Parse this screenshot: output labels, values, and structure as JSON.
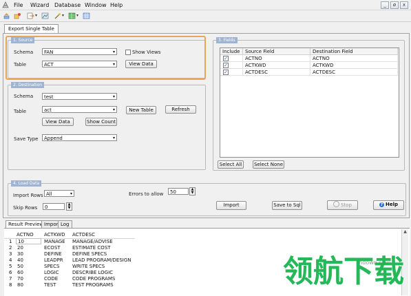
{
  "menu": [
    "File",
    "Wizard",
    "Database",
    "Window",
    "Help"
  ],
  "window_controls": [
    "_",
    "ø",
    "x"
  ],
  "document_tab": "Export Single Table",
  "source": {
    "title": "1. Source",
    "schema_label": "Schema",
    "schema_value": "FAN",
    "table_label": "Table",
    "table_value": "ACT",
    "show_views_label": "Show Views",
    "view_data_label": "View Data"
  },
  "destination": {
    "title": "2. Destination",
    "schema_label": "Schema",
    "schema_value": "test",
    "table_label": "Table",
    "table_value": "act",
    "new_table_label": "New Table",
    "refresh_label": "Refresh",
    "view_data_label": "View Data",
    "show_count_label": "Show Count",
    "save_type_label": "Save Type",
    "save_type_value": "Append"
  },
  "fields": {
    "title": "3. Fields",
    "headers": [
      "Include",
      "Source Field",
      "Destination Field"
    ],
    "rows": [
      {
        "source": "ACTNO",
        "dest": "ACTNO"
      },
      {
        "source": "ACTKWD",
        "dest": "ACTKWD"
      },
      {
        "source": "ACTDESC",
        "dest": "ACTDESC"
      }
    ],
    "select_all_label": "Select All",
    "select_none_label": "Select None"
  },
  "load": {
    "title": "4. Load Data",
    "import_rows_label": "Import Rows",
    "import_rows_value": "All",
    "skip_rows_label": "Skip Rows",
    "skip_rows_value": "0",
    "errors_label": "Errors to allow",
    "errors_value": "50",
    "import_label": "Import",
    "save_sql_label": "Save to Sql",
    "stop_label": "Stop",
    "help_label": "Help"
  },
  "panel_tabs": [
    "Result Preview",
    "Import",
    "Log"
  ],
  "preview": {
    "headers": [
      "ACTNO",
      "ACTKWD",
      "ACTDESC"
    ],
    "rows": [
      [
        "1",
        "10",
        "MANAGE",
        "MANAGE/ADVISE"
      ],
      [
        "2",
        "20",
        "ECOST",
        "ESTIMATE COST"
      ],
      [
        "3",
        "30",
        "DEFINE",
        "DEFINE SPECS"
      ],
      [
        "4",
        "40",
        "LEADPR",
        "LEAD PROGRAM/DESIGN"
      ],
      [
        "5",
        "50",
        "SPECS",
        "WRITE SPECS"
      ],
      [
        "6",
        "60",
        "LOGIC",
        "DESCRIBE LOGIC"
      ],
      [
        "7",
        "70",
        "CODE",
        "CODE PROGRAMS"
      ],
      [
        "8",
        "80",
        "TEST",
        "TEST PROGRAMS"
      ]
    ]
  },
  "watermark": {
    "text": "领航下载",
    "url": "lhdown.com"
  },
  "colors": {
    "highlight": "#e9a455",
    "group_title": "#9fb4d3",
    "watermark": "#13b24a"
  }
}
